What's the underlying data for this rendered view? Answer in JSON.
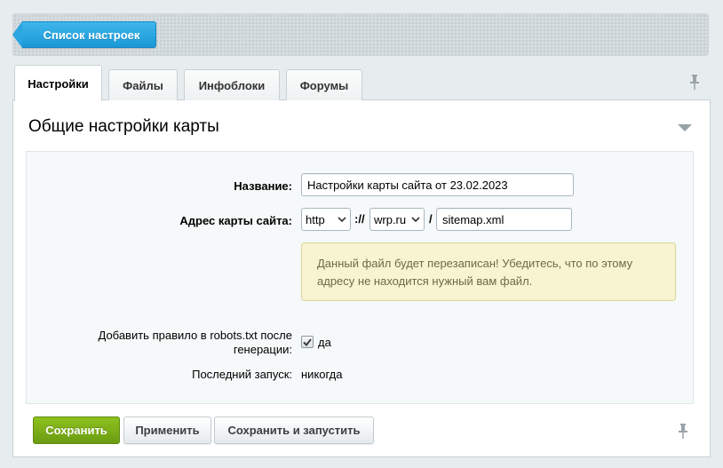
{
  "toolbar": {
    "back_label": "Список настроек"
  },
  "tabs": [
    {
      "label": "Настройки",
      "active": true
    },
    {
      "label": "Файлы",
      "active": false
    },
    {
      "label": "Инфоблоки",
      "active": false
    },
    {
      "label": "Форумы",
      "active": false
    }
  ],
  "section": {
    "title": "Общие настройки карты"
  },
  "form": {
    "name_label": "Название:",
    "name_value": "Настройки карты сайта от 23.02.2023",
    "address_label": "Адрес карты сайта:",
    "protocol_value": "http",
    "protocol_separator": "://",
    "domain_value": "wrp.ru",
    "path_separator": "/",
    "file_value": "sitemap.xml",
    "notice_text": "Данный файл будет перезаписан! Убедитесь, что по этому адресу не находится нужный вам файл.",
    "robots_label": "Добавить правило в robots.txt после генерации:",
    "robots_checked": true,
    "robots_value": "да",
    "last_run_label": "Последний запуск:",
    "last_run_value": "никогда"
  },
  "buttons": {
    "save": "Сохранить",
    "apply": "Применить",
    "save_run": "Сохранить и запустить"
  },
  "icons": {
    "pin": "pin-icon",
    "collapse": "chevron-down-icon",
    "select_arrow": "chevron-down-icon",
    "check": "checkmark-icon"
  },
  "colors": {
    "accent_blue": "#1a98d6",
    "primary_green": "#7cb018",
    "notice_bg": "#f8f3d0"
  }
}
